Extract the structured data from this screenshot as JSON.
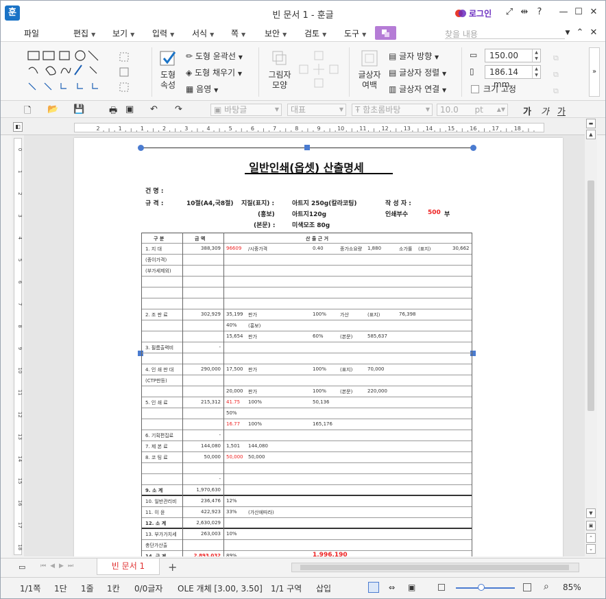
{
  "title": "빈 문서 1 - 훈글",
  "app_icon": "훈",
  "login": "로그인",
  "menu": [
    {
      "label": "파일",
      "arrow": false
    },
    {
      "label": "편집",
      "arrow": true
    },
    {
      "label": "보기",
      "arrow": true
    },
    {
      "label": "입력",
      "arrow": true
    },
    {
      "label": "서식",
      "arrow": true
    },
    {
      "label": "쪽",
      "arrow": true
    },
    {
      "label": "보안",
      "arrow": true
    },
    {
      "label": "검토",
      "arrow": true
    },
    {
      "label": "도구",
      "arrow": true
    }
  ],
  "search_placeholder": "찾을 내용",
  "ribbon": {
    "shape_props": "도형\n속성",
    "outline": "도형 윤곽선",
    "fill": "도형 채우기",
    "shade": "음영",
    "shadow_shape": "그림자\n모양",
    "textbox_margin": "글상자\n여백",
    "text_direction": "글자 방향",
    "textbox_align": "글상자 정렬",
    "textbox_link": "글상자 연결",
    "width_value": "150.00",
    "height_value": "186.14",
    "unit": "mm",
    "fixed_size": "크기 고정"
  },
  "format": {
    "style": "바탕글",
    "lang": "대표",
    "font": "함초롬바탕",
    "size": "10.0",
    "size_unit": "pt",
    "g1": "가",
    "g2": "가",
    "g3": "가"
  },
  "ruler_h_labels": [
    "2",
    "1",
    "1",
    "2",
    "3",
    "4",
    "5",
    "6",
    "7",
    "8",
    "9",
    "10",
    "11",
    "12",
    "13",
    "14",
    "15",
    "16",
    "17",
    "18"
  ],
  "ruler_v_labels": [
    "0",
    "1",
    "2",
    "3",
    "4",
    "5",
    "6",
    "7",
    "8",
    "9",
    "10",
    "11",
    "12",
    "13",
    "14",
    "15",
    "16",
    "17",
    "18"
  ],
  "document": {
    "form_title": "일반인쇄(옵셋) 산출명세",
    "header": {
      "case_label": "건     명 :",
      "spec_label": "규     격 :",
      "spec_value": "10절(A4,국8절)",
      "paper_label": "지질(표지) :",
      "paper1": "아트지 250g(칼라코팅)",
      "body_label": "(홍보)",
      "paper2": "아트지120g",
      "inner_label": "(본문) :",
      "paper3": "미색모조 80g",
      "author_label": "작 성 자 :",
      "copies_label": "인쇄부수",
      "copies_value": "500",
      "copies_unit": "부"
    },
    "col_headers": [
      "구   분",
      "금   액",
      "산     출     근     거"
    ],
    "rows": [
      {
        "name": "1. 지     대",
        "amount": "388,309"
      },
      {
        "name": "(종이가격)",
        "amount": ""
      },
      {
        "name": "(부가세제외)",
        "amount": ""
      },
      {
        "name": "",
        "amount": ""
      },
      {
        "name": "",
        "amount": ""
      },
      {
        "name": "",
        "amount": ""
      },
      {
        "name": "2. 조  판  료",
        "amount": "302,929"
      },
      {
        "name": "",
        "amount": ""
      },
      {
        "name": "",
        "amount": ""
      },
      {
        "name": "3. 필름출력비",
        "amount": "-"
      },
      {
        "name": "",
        "amount": ""
      },
      {
        "name": "4. 인 쇄 판 대",
        "amount": "290,000"
      },
      {
        "name": "(CTP판등)",
        "amount": ""
      },
      {
        "name": "",
        "amount": ""
      },
      {
        "name": "5. 인   쇄   료",
        "amount": "215,312"
      },
      {
        "name": "",
        "amount": ""
      },
      {
        "name": "",
        "amount": ""
      },
      {
        "name": "6. 기획편집료",
        "amount": "-"
      },
      {
        "name": "7. 제   본   료",
        "amount": "144,080"
      },
      {
        "name": "8. 코  팅  료",
        "amount": "50,000"
      },
      {
        "name": "",
        "amount": ""
      },
      {
        "name": "",
        "amount": "-"
      },
      {
        "name": "9. 소     계",
        "amount": "1,970,630"
      },
      {
        "name": "10. 일반관리비",
        "amount": "236,476"
      },
      {
        "name": "11. 이     윤",
        "amount": "422,923"
      },
      {
        "name": "12. 소     계",
        "amount": "2,630,029"
      },
      {
        "name": "13. 부가가치세",
        "amount": "263,003"
      },
      {
        "name": "총단가산출",
        "amount": ""
      },
      {
        "name": "14. 금     계",
        "amount": "2,893,032"
      }
    ],
    "basis_snippets": {
      "r0": [
        "96609",
        "/시중가격",
        "0.40",
        "종가소요량",
        "1,880",
        "소가률",
        "(표지)",
        "30,662"
      ],
      "r6": [
        "35,199",
        "판가",
        "100%",
        "가산",
        "(표지)",
        "76,398"
      ],
      "r6b": [
        "40%",
        "(홍보)"
      ],
      "r6c": [
        "15,654",
        "판가",
        "60%",
        "(본문)",
        "585,637"
      ],
      "r11": [
        "17,500",
        "판가",
        "100%",
        "(표지)",
        "70,000"
      ],
      "r11c": [
        "20,000",
        "판가",
        "100%",
        "(본문)",
        "220,000"
      ],
      "r14": [
        "41.75",
        "100%",
        "50,136"
      ],
      "r14b": [
        "50%"
      ],
      "r14c": [
        "16.77",
        "100%",
        "165,176"
      ],
      "r18": [
        "1,501",
        "144,080"
      ],
      "r19": [
        "50,000",
        "50,000"
      ],
      "r23": [
        "12%"
      ],
      "r24": [
        "33%",
        "(가산에따라)"
      ],
      "r26": [
        "10%"
      ],
      "r28pct": "89%",
      "r28total": "1,996,190"
    }
  },
  "tab_label": "빈 문서 1",
  "status": {
    "page": "1/1쪽",
    "col": "1단",
    "line": "1줄",
    "cell": "1칸",
    "chars": "0/0글자",
    "object": "OLE 개체 [3.00, 3.50]",
    "section": "1/1 구역",
    "mode": "삽입",
    "zoom": "85%"
  }
}
